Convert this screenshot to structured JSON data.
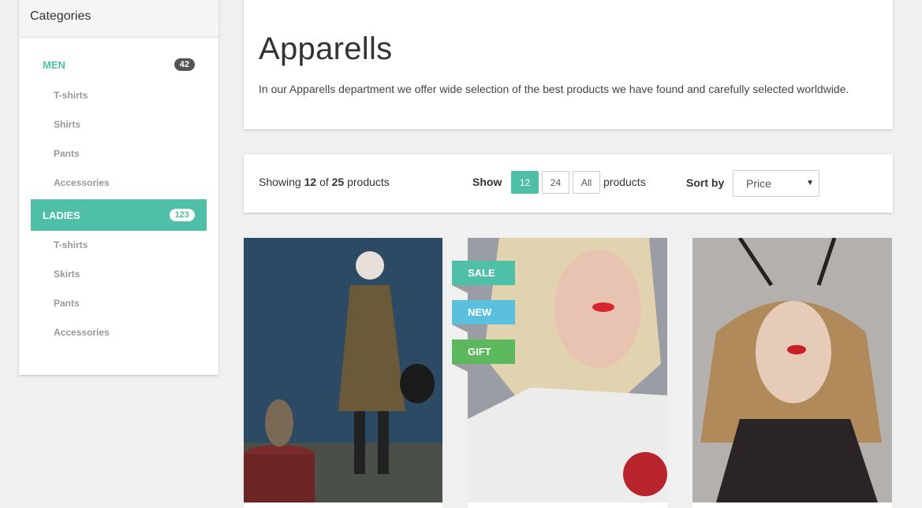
{
  "sidebar": {
    "title": "Categories",
    "categories": [
      {
        "label": "MEN",
        "count": "42",
        "items": [
          "T-shirts",
          "Shirts",
          "Pants",
          "Accessories"
        ]
      },
      {
        "label": "LADIES",
        "count": "123",
        "items": [
          "T-shirts",
          "Skirts",
          "Pants",
          "Accessories"
        ]
      }
    ]
  },
  "header": {
    "title": "Apparells",
    "description": "In our Apparells department we offer wide selection of the best products we have found and carefully selected worldwide."
  },
  "toolbar": {
    "showing_prefix": "Showing",
    "showing_count": "12",
    "showing_of": "of",
    "showing_total": "25",
    "showing_suffix": "products",
    "show_label": "Show",
    "page_sizes": [
      "12",
      "24",
      "All"
    ],
    "active_page_size": "12",
    "products_label": "products",
    "sort_label": "Sort by",
    "sort_value": "Price"
  },
  "ribbons": [
    "SALE",
    "NEW",
    "GIFT"
  ],
  "colors": {
    "accent": "#4fbfa8",
    "new": "#5bc0de",
    "gift": "#5cb85c"
  }
}
